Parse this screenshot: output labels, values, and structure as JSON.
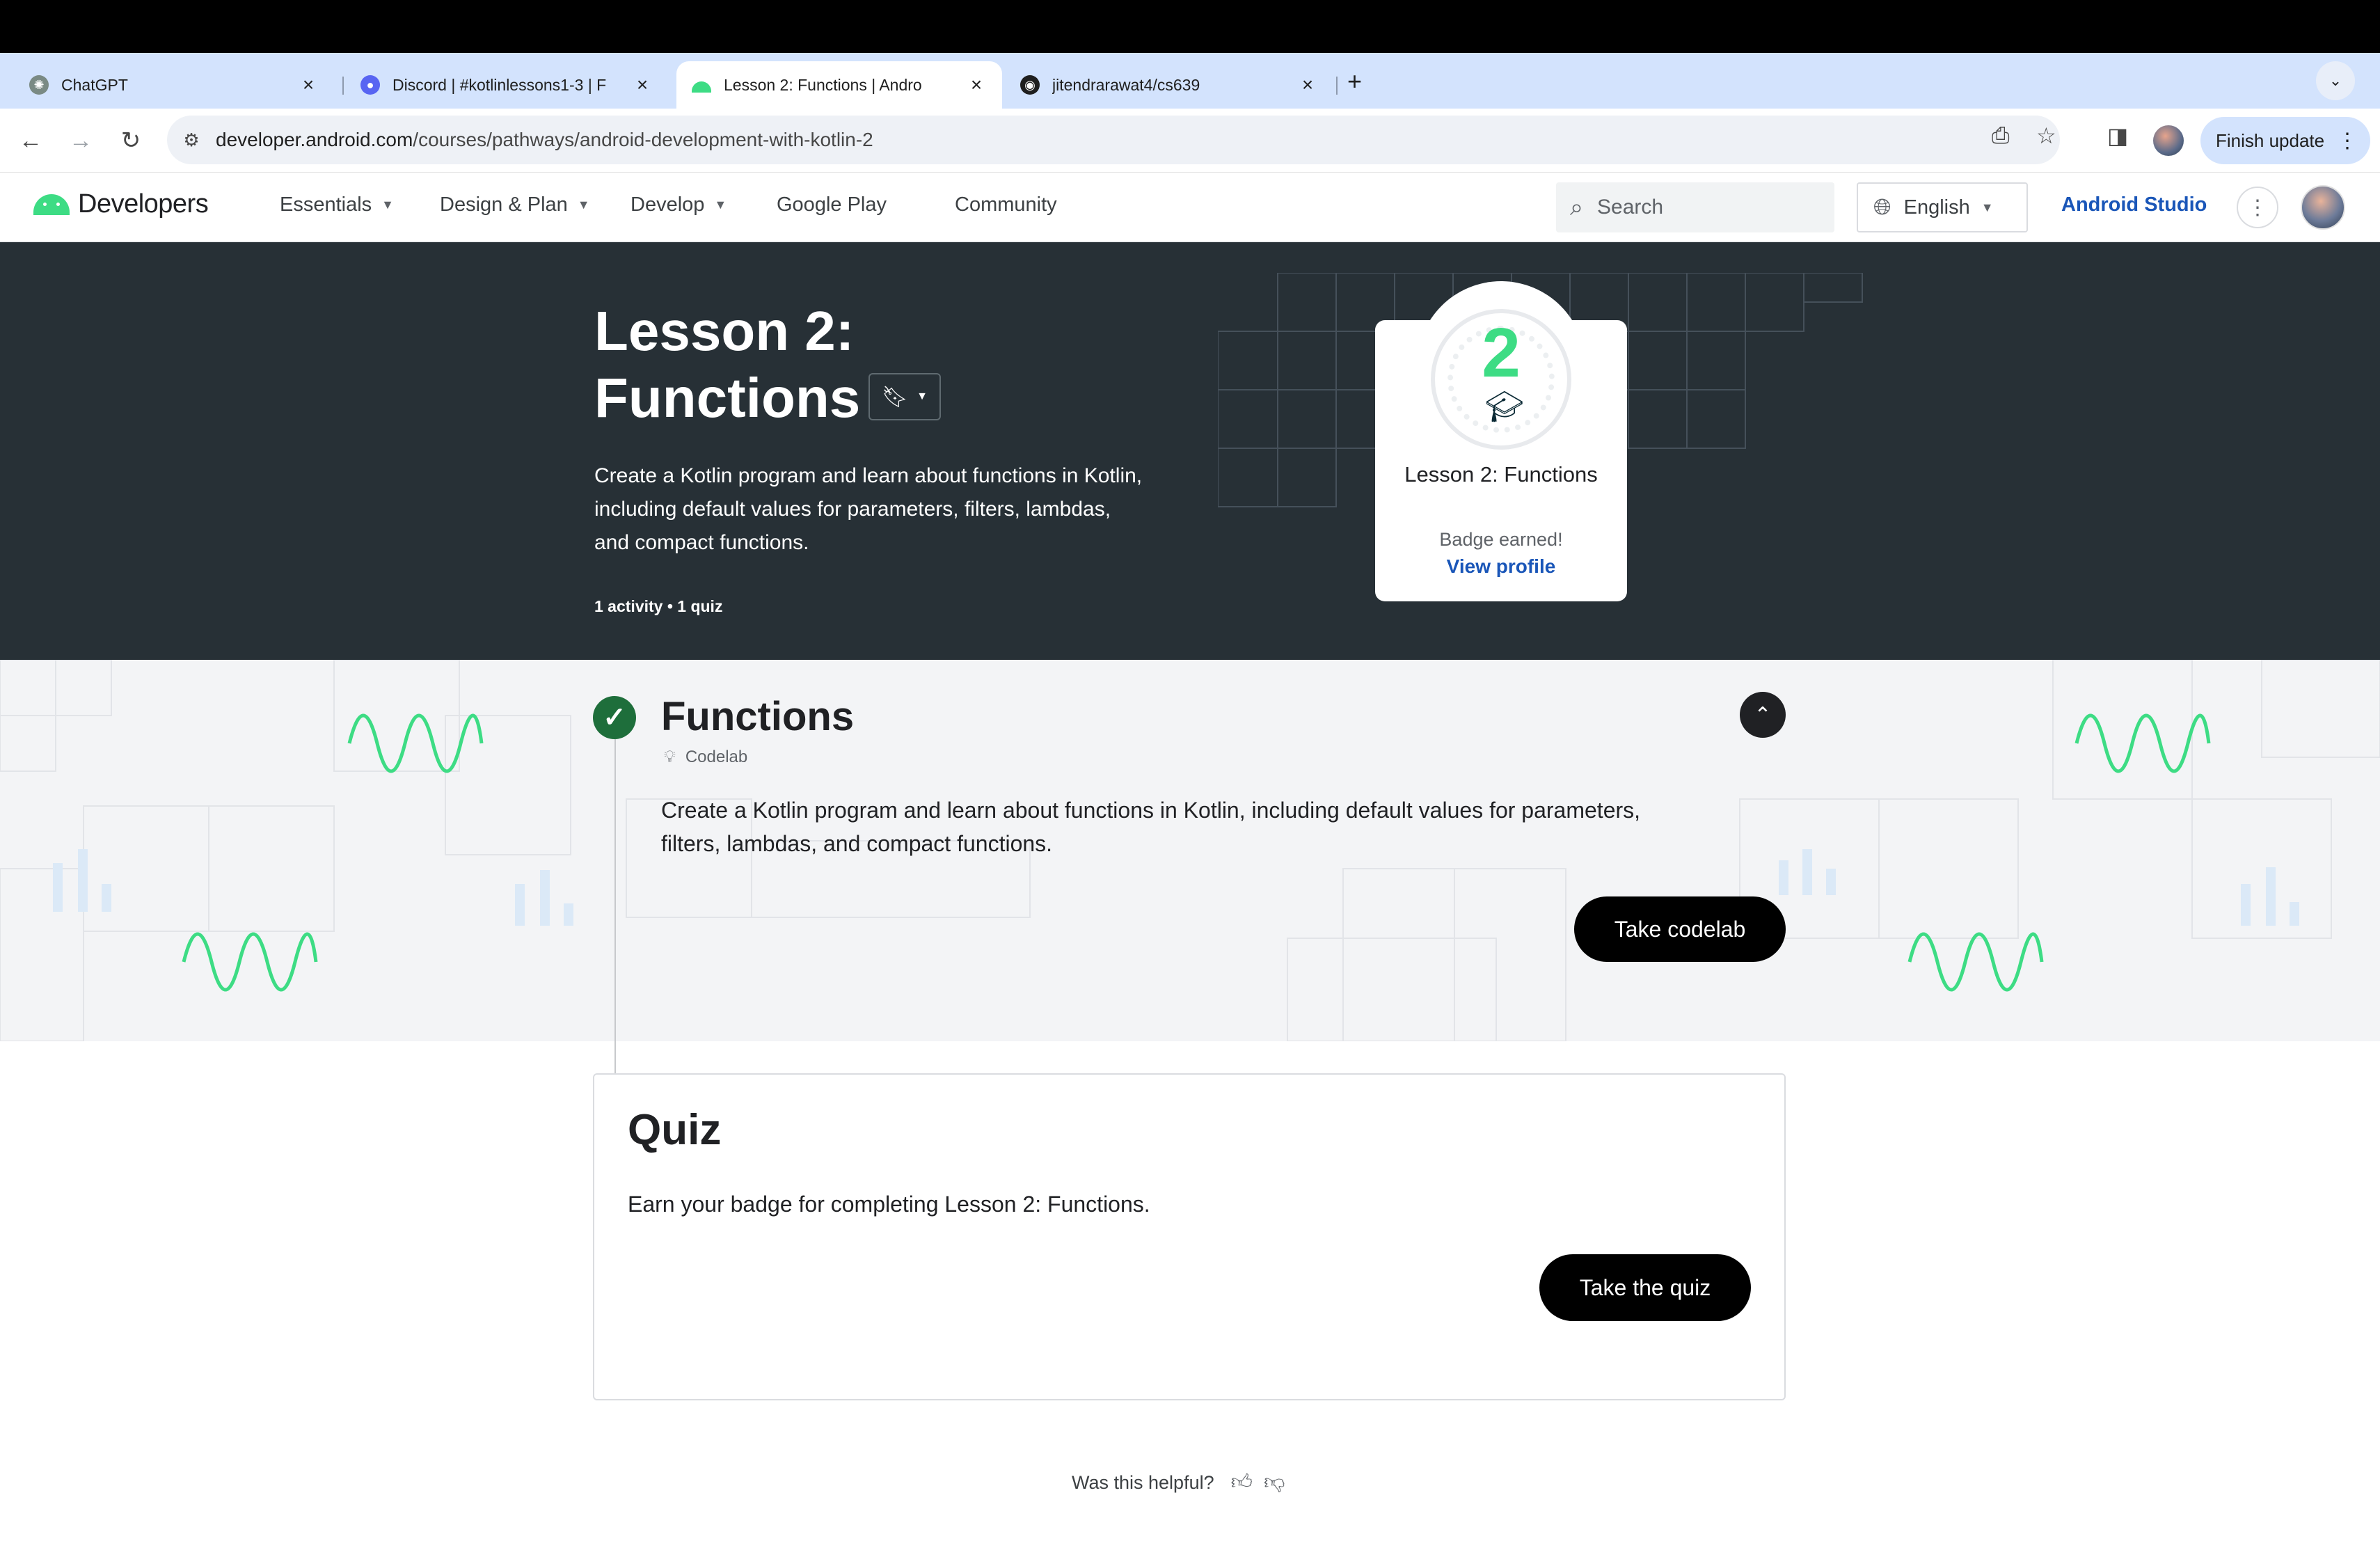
{
  "browser": {
    "tabs": [
      {
        "title": "ChatGPT",
        "icon": "chatgpt-icon"
      },
      {
        "title": "Discord | #kotlinlessons1-3 | F",
        "icon": "discord-icon"
      },
      {
        "title": "Lesson 2: Functions  |  Andro",
        "icon": "android-icon",
        "active": true
      },
      {
        "title": "jitendrarawat4/cs639",
        "icon": "github-icon"
      }
    ],
    "url_host": "developer.android.com",
    "url_path": "/courses/pathways/android-development-with-kotlin-2",
    "finish_update_label": "Finish update"
  },
  "site": {
    "logo_text": "Developers",
    "menu": [
      {
        "label": "Essentials",
        "dropdown": true
      },
      {
        "label": "Design & Plan",
        "dropdown": true
      },
      {
        "label": "Develop",
        "dropdown": true
      },
      {
        "label": "Google Play",
        "dropdown": false
      },
      {
        "label": "Community",
        "dropdown": false
      }
    ],
    "search_placeholder": "Search",
    "language": "English",
    "studio_link": "Android Studio"
  },
  "hero": {
    "title_line1": "Lesson 2:",
    "title_line2": "Functions",
    "description": "Create a Kotlin program and learn about functions in Kotlin, including default values for parameters, filters, lambdas, and compact functions.",
    "meta": "1 activity • 1 quiz",
    "badge": {
      "number": "2",
      "name": "Lesson 2: Functions",
      "earned_text": "Badge earned!",
      "view_profile": "View profile"
    }
  },
  "codelab": {
    "title": "Functions",
    "type": "Codelab",
    "description": "Create a Kotlin program and learn about functions in Kotlin, including default values for parameters, filters, lambdas, and compact functions.",
    "button": "Take codelab",
    "completed": true
  },
  "quiz": {
    "title": "Quiz",
    "description": "Earn your badge for completing Lesson 2: Functions.",
    "button": "Take the quiz"
  },
  "feedback": {
    "question": "Was this helpful?"
  },
  "colors": {
    "hero_bg": "#273036",
    "accent_green": "#3ddc84",
    "link_blue": "#1a56b8"
  }
}
